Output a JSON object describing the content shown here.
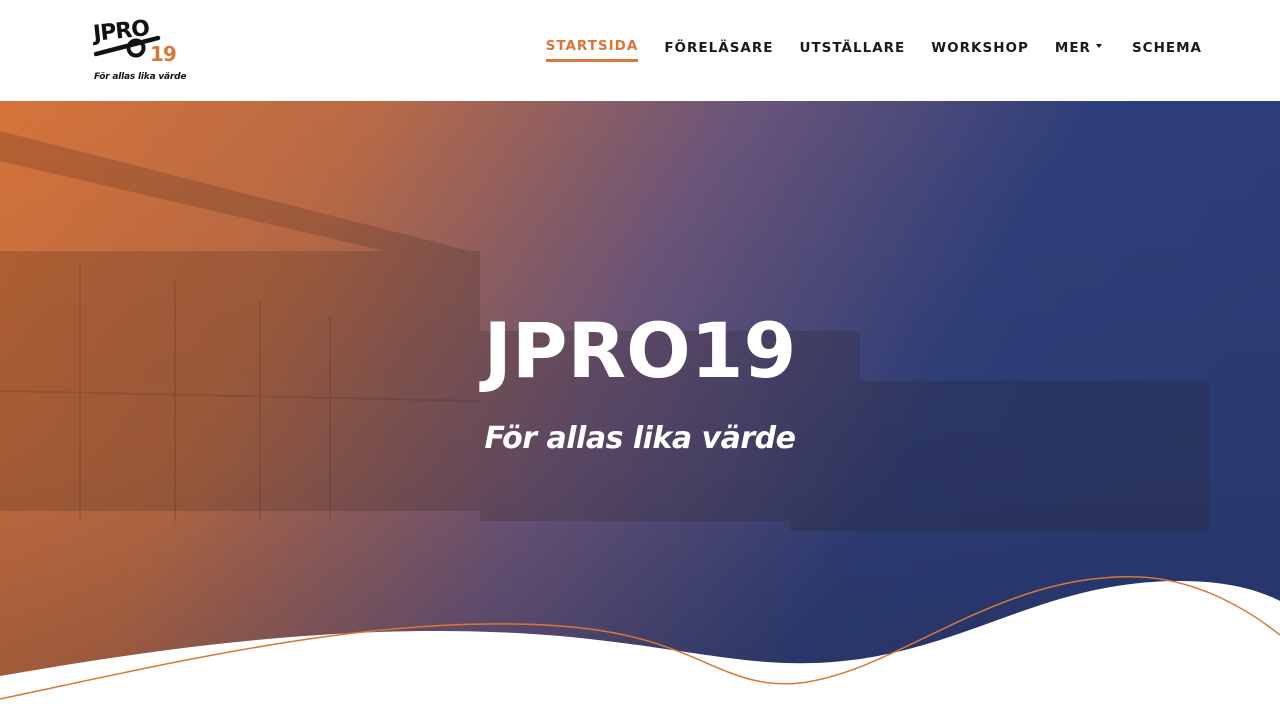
{
  "logo": {
    "text": "JPRO",
    "number": "19",
    "tagline": "För allas lika värde",
    "colors": {
      "dark": "#111111",
      "accent": "#d9773a"
    }
  },
  "nav": {
    "items": [
      {
        "label": "STARTSIDA",
        "active": true
      },
      {
        "label": "FÖRELÄSARE",
        "active": false
      },
      {
        "label": "UTSTÄLLARE",
        "active": false
      },
      {
        "label": "WORKSHOP",
        "active": false
      },
      {
        "label": "MER",
        "active": false,
        "icon": "caret-down-icon"
      },
      {
        "label": "SCHEMA",
        "active": false
      }
    ]
  },
  "hero": {
    "title": "JPRO19",
    "subtitle": "För allas lika värde",
    "gradient": {
      "from": "#d9773a",
      "to": "#2f3f7a"
    }
  }
}
